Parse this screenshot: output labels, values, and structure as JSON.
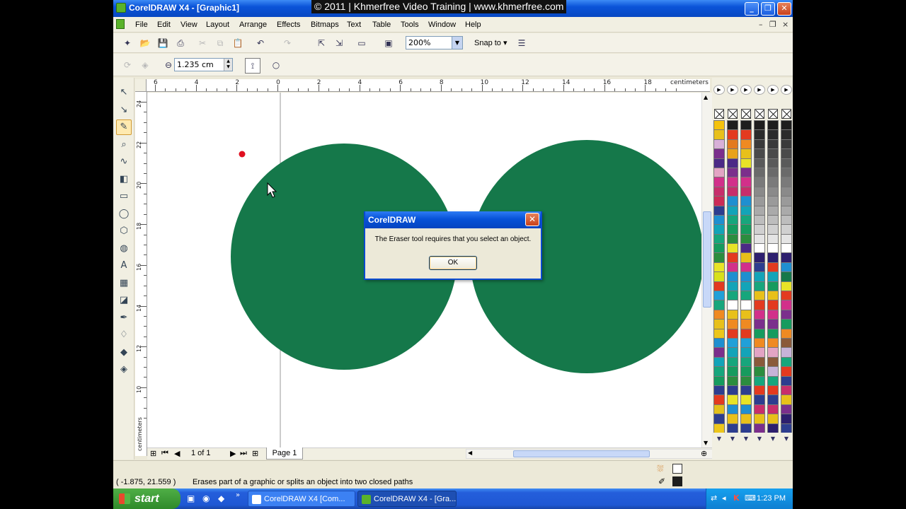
{
  "window": {
    "title": "CorelDRAW X4 - [Graphic1]",
    "watermark": "© 2011 | Khmerfree Video Training | www.khmerfree.com",
    "min": "_",
    "max": "❐",
    "close": "✕"
  },
  "menu": {
    "items": [
      "File",
      "Edit",
      "View",
      "Layout",
      "Arrange",
      "Effects",
      "Bitmaps",
      "Text",
      "Table",
      "Tools",
      "Window",
      "Help"
    ],
    "doc_controls": [
      "–",
      "❐",
      "×"
    ]
  },
  "toolbar": {
    "zoom_value": "200%",
    "snap_label": "Snap to",
    "snap_arrow": "▾"
  },
  "property_bar": {
    "thickness_value": "1.235 cm"
  },
  "ruler": {
    "unit": "centimeters",
    "top_labels": [
      "6",
      "4",
      "2",
      "0",
      "2",
      "4",
      "6",
      "8",
      "10",
      "12",
      "14",
      "16",
      "18"
    ],
    "left_labels": [
      "24",
      "22",
      "20",
      "18",
      "16",
      "14",
      "12",
      "10"
    ],
    "left_unit": "centimeters"
  },
  "document": {
    "page_count": "1 of 1",
    "page_tab": "Page 1",
    "shape_color": "#15784a",
    "marker_color": "#e01020"
  },
  "dialog": {
    "title": "CorelDRAW",
    "message": "The Eraser tool requires that you select an object.",
    "ok_label": "OK"
  },
  "status": {
    "coords": "( -1.875, 21.559 )",
    "hint": "Erases part of a graphic or splits an object into two closed paths"
  },
  "taskbar": {
    "start_label": "start",
    "tasks": [
      "CorelDRAW X4 [Com...",
      "CorelDRAW X4 - [Gra..."
    ],
    "clock": "1:23 PM"
  },
  "palettes": [
    [
      "#f4c20d",
      "#e8c01a",
      "#d8b0d8",
      "#7b2f8c",
      "#4b2a86",
      "#e3a4c4",
      "#d2308a",
      "#c72e6b",
      "#cb2b57",
      "#2d3d8f",
      "#1f8fd0",
      "#13a4b8",
      "#17a67c",
      "#169b5e",
      "#2b8d3e",
      "#e8e327",
      "#d8e01a",
      "#e33a1f",
      "#21a0d8",
      "#17a67c",
      "#ef8a22",
      "#e8c01a",
      "#edc61a",
      "#1f8fd0",
      "#7b2f8c",
      "#13a4b8",
      "#17a67c",
      "#169b5e",
      "#2d3d8f",
      "#e33a1f",
      "#e3c01a",
      "#2d3d8f",
      "#edc61a"
    ],
    [
      "#1e1e1e",
      "#e33a1f",
      "#e37a1f",
      "#e8a21a",
      "#4b2a86",
      "#7b2f8c",
      "#d2308a",
      "#c72e6b",
      "#1f8fd0",
      "#13a4b8",
      "#17a67c",
      "#169b5e",
      "#2b8d3e",
      "#e8e327",
      "#e33a1f",
      "#d2308a",
      "#1f8fd0",
      "#13a4b8",
      "#17a67c",
      "#ffffff",
      "#e8c01a",
      "#ef8a22",
      "#e33a1f",
      "#21a0d8",
      "#13a4b8",
      "#17a67c",
      "#169b5e",
      "#2b8d3e",
      "#2d3d8f",
      "#e8e327",
      "#1f8fd0",
      "#e8c01a",
      "#2d3d8f"
    ],
    [
      "#1e1e1e",
      "#e33a1f",
      "#ef8a22",
      "#e8c01a",
      "#e8e327",
      "#7b2f8c",
      "#d2308a",
      "#c72e6b",
      "#1f8fd0",
      "#13a4b8",
      "#17a67c",
      "#169b5e",
      "#2b8d3e",
      "#4b2a86",
      "#e8c01a",
      "#d2308a",
      "#1f8fd0",
      "#13a4b8",
      "#17a67c",
      "#ffffff",
      "#e8c01a",
      "#ef8a22",
      "#e33a1f",
      "#21a0d8",
      "#13a4b8",
      "#17a67c",
      "#169b5e",
      "#2b8d3e",
      "#2d3d8f",
      "#e8e327",
      "#1f8fd0",
      "#e8c01a",
      "#2d3d8f"
    ],
    [
      "#1e1e1e",
      "#2b2b2b",
      "#3a3a3a",
      "#4a4a4a",
      "#5a5a5a",
      "#6a6a6a",
      "#7a7a7a",
      "#8a8a8a",
      "#9a9a9a",
      "#aaaaaa",
      "#bdbdbd",
      "#d0d0d0",
      "#e4e4e4",
      "#ffffff",
      "#2d1f6e",
      "#2d3d8f",
      "#13a4b8",
      "#17a67c",
      "#e8c01a",
      "#e33a1f",
      "#d2308a",
      "#7b2f8c",
      "#169b5e",
      "#ef8a22",
      "#e3a4c4",
      "#8a5a3a",
      "#2b8d3e",
      "#17a67c",
      "#e33a1f",
      "#2d3d8f",
      "#c72e6b",
      "#e8c01a",
      "#7b2f8c"
    ],
    [
      "#1e1e1e",
      "#2b2b2b",
      "#3a3a3a",
      "#4a4a4a",
      "#5a5a5a",
      "#6a6a6a",
      "#7a7a7a",
      "#8a8a8a",
      "#9a9a9a",
      "#aaaaaa",
      "#bdbdbd",
      "#d0d0d0",
      "#e4e4e4",
      "#ffffff",
      "#2d1f6e",
      "#e33a1f",
      "#13a4b8",
      "#169b5e",
      "#e8c01a",
      "#e33a1f",
      "#d2308a",
      "#7b2f8c",
      "#169b5e",
      "#ef8a22",
      "#e3a4c4",
      "#8a5a3a",
      "#c7b3d8",
      "#17a67c",
      "#e33a1f",
      "#2d3d8f",
      "#c72e6b",
      "#e8c01a",
      "#2d1f6e"
    ],
    [
      "#1e1e1e",
      "#2b2b2b",
      "#3a3a3a",
      "#4a4a4a",
      "#5a5a5a",
      "#6a6a6a",
      "#7a7a7a",
      "#8a8a8a",
      "#9a9a9a",
      "#aaaaaa",
      "#bdbdbd",
      "#d0d0d0",
      "#e4e4e4",
      "#ffffff",
      "#2d1f6e",
      "#1f8fd0",
      "#15784a",
      "#e8e327",
      "#e33a1f",
      "#d2308a",
      "#7b2f8c",
      "#169b5e",
      "#ef8a22",
      "#8a5a3a",
      "#c7b3d8",
      "#17a67c",
      "#e33a1f",
      "#2d3d8f",
      "#c72e6b",
      "#e8c01a",
      "#7b2f8c",
      "#2d1f6e",
      "#2d3d8f"
    ]
  ]
}
